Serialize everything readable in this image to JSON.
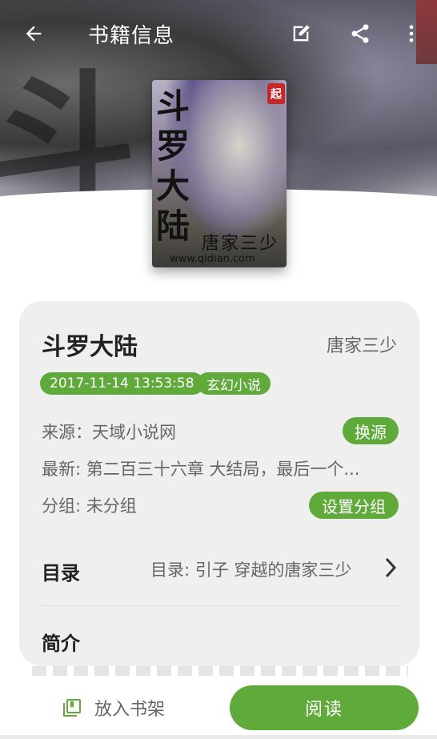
{
  "header": {
    "title": "书籍信息",
    "back_icon": "arrow-left-icon",
    "edit_icon": "edit-icon",
    "share_icon": "share-icon",
    "more_icon": "more-vertical-icon"
  },
  "cover": {
    "title_chars": [
      "斗",
      "罗",
      "大",
      "陆"
    ],
    "badge": "起",
    "author": "唐家三少",
    "url": "www.qidian.com"
  },
  "book": {
    "name": "斗罗大陆",
    "author": "唐家三少",
    "update_time": "2017-11-14 13:53:58",
    "kind": "玄幻小说",
    "source": "来源：天域小说网",
    "latest": "最新: 第二百三十六章 大结局，最后一个...",
    "group": "分组: 未分组",
    "change_source_label": "换源",
    "set_group_label": "设置分组"
  },
  "toc": {
    "label": "目录",
    "value": "目录: 引子 穿越的唐家三少"
  },
  "intro": {
    "label": "简介"
  },
  "bottom": {
    "add_shelf_label": "放入书架",
    "read_label": "阅读"
  },
  "colors": {
    "accent": "#5faa3a",
    "card_bg": "#efefef"
  }
}
